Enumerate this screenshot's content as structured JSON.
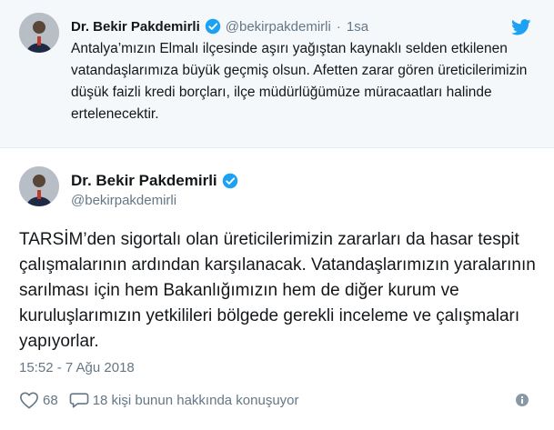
{
  "parent_tweet": {
    "author_name": "Dr. Bekir Pakdemirli",
    "handle": "@bekirpakdemirli",
    "separator": "·",
    "time": "1sa",
    "text": "Antalya’mızın Elmalı ilçesinde aşırı yağıştan kaynaklı selden etkilenen vatandaşlarımıza büyük geçmiş olsun. Afetten zarar gören üreticilerimizin düşük faizli kredi borçları, ilçe müdürlüğümüze müracaatları halinde ertelenecektir."
  },
  "main_tweet": {
    "author_name": "Dr. Bekir Pakdemirli",
    "handle": "@bekirpakdemirli",
    "text": "TARSİM’den sigortalı olan üreticilerimizin zararları da hasar tespit çalışmalarının ardından karşılanacak. Vatandaşlarımızın yaralarının sarılması için hem Bakanlığımızın hem de diğer kurum ve kuruluşlarımızın yetkilileri bölgede gerekli inceleme ve çalışmaları yapıyorlar.",
    "timestamp": "15:52 - 7 Ağu 2018",
    "likes": "68",
    "replies_text": "18 kişi bunun hakkında konuşuyor"
  },
  "icons": {
    "verified": "verified-badge-icon",
    "brand": "twitter-bird-icon",
    "like": "heart-icon",
    "reply": "speech-bubble-icon",
    "info": "info-icon"
  },
  "colors": {
    "brand_blue": "#1da1f2",
    "text": "#14171a",
    "muted": "#657786",
    "parent_bg": "#f5f8fa"
  }
}
